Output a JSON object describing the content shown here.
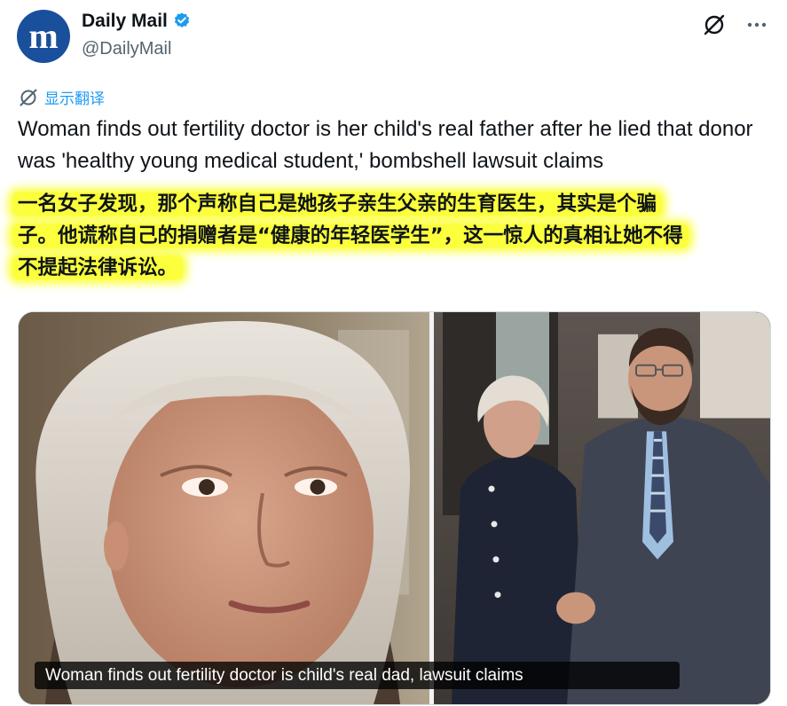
{
  "account": {
    "name": "Daily Mail",
    "handle": "@DailyMail",
    "avatar_letter": "m",
    "verified_color": "#1d9bf0",
    "avatar_color": "#1a4f9c"
  },
  "actions": {
    "grok_icon": "grok-icon",
    "more_icon": "more-icon"
  },
  "translate_label": "显示翻译",
  "tweet_text": "Woman finds out fertility doctor is her child's real father after he lied that donor was 'healthy young medical student,' bombshell lawsuit claims",
  "translation_overlay": {
    "line1": "一名女子发现，那个声称自己是她孩子亲生父亲的生育医生，其实是个骗",
    "line2": "子。他谎称自己的捐赠者是“健康的年轻医学生”，这一惊人的真相让她不得",
    "line3": "不提起法律诉讼。",
    "highlight_color": "#fbff3c"
  },
  "media": {
    "caption": "Woman finds out fertility doctor is child's real dad, lawsuit claims"
  }
}
